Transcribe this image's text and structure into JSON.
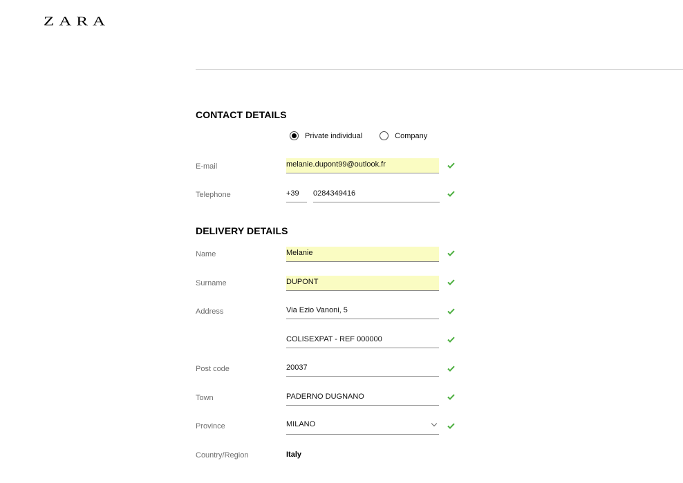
{
  "brand": {
    "logo_text": "ZARA"
  },
  "contact": {
    "title": "CONTACT DETAILS",
    "customer_types": [
      {
        "label": "Private individual",
        "selected": true
      },
      {
        "label": "Company",
        "selected": false
      }
    ],
    "email": {
      "label": "E-mail",
      "value": "melanie.dupont99@outlook.fr",
      "valid": true
    },
    "telephone": {
      "label": "Telephone",
      "prefix": "+39",
      "number": "0284349416",
      "valid": true
    }
  },
  "delivery": {
    "title": "DELIVERY DETAILS",
    "name": {
      "label": "Name",
      "value": "Melanie",
      "valid": true
    },
    "surname": {
      "label": "Surname",
      "value": "DUPONT",
      "valid": true
    },
    "address": {
      "label": "Address",
      "line1": "Via Ezio Vanoni, 5",
      "line2": "COLISEXPAT - REF 000000",
      "valid": true
    },
    "post_code": {
      "label": "Post code",
      "value": "20037",
      "valid": true
    },
    "town": {
      "label": "Town",
      "value": "PADERNO DUGNANO",
      "valid": true
    },
    "province": {
      "label": "Province",
      "value": "MILANO",
      "valid": true
    },
    "country": {
      "label": "Country/Region",
      "value": "Italy"
    }
  },
  "colors": {
    "valid_check": "#4caf3f",
    "autofill_bg": "#fafcc2"
  },
  "icons": {
    "valid": "check-icon",
    "dropdown": "chevron-down-icon"
  }
}
